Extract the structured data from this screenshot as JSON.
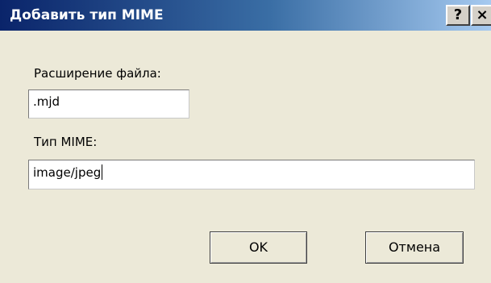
{
  "window": {
    "title": "Добавить тип MIME",
    "help_label": "?",
    "close_label": "×"
  },
  "form": {
    "extension_label": "Расширение файла:",
    "extension_value": ".mjd",
    "mime_label": "Тип MIME:",
    "mime_value": "image/jpeg"
  },
  "buttons": {
    "ok_label": "OK",
    "cancel_label": "Отмена"
  },
  "colors": {
    "titlebar_start": "#0a246a",
    "titlebar_end": "#a6caf0",
    "dialog_background": "#ece9d8"
  }
}
